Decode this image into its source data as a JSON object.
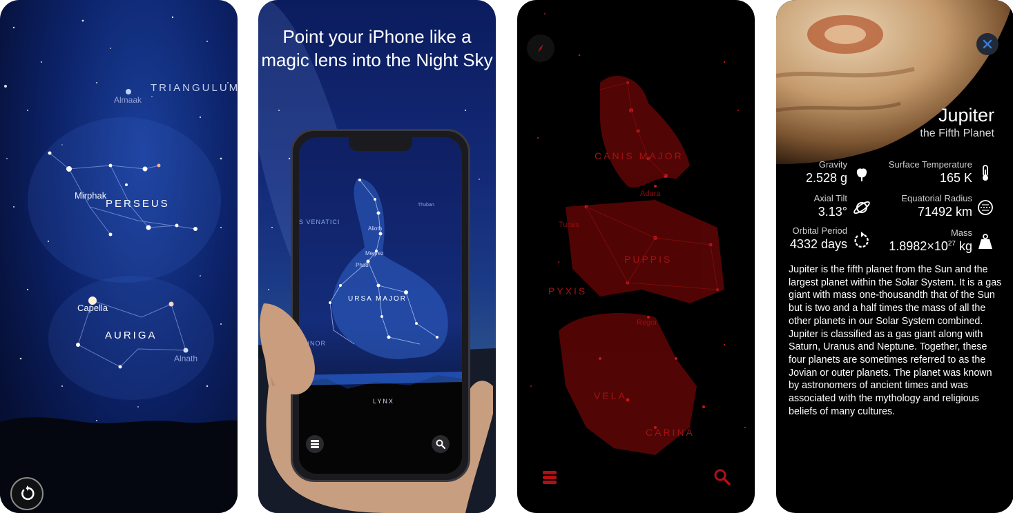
{
  "screen1": {
    "constellations": [
      "TRIANGULUM",
      "PERSEUS",
      "AURIGA"
    ],
    "stars": [
      "Almaak",
      "Mirphak",
      "Capella",
      "Alnath"
    ],
    "reset_icon": "rotate-icon"
  },
  "screen2": {
    "headline": "Point your iPhone like a magic lens into the Night Sky",
    "labels": [
      "S VENATICI",
      "Alioth",
      "Megrez",
      "Phad",
      "URSA MAJOR",
      "MINOR",
      "LYNX",
      "Thuban"
    ],
    "menu_icon": "layers-icon",
    "search_icon": "search-icon"
  },
  "screen3": {
    "constellations": [
      "CANIS MAJOR",
      "PUPPIS",
      "PYXIS",
      "VELA",
      "CARINA"
    ],
    "stars": [
      "Adara",
      "Turais",
      "Regor"
    ],
    "compass_icon": "compass-icon",
    "menu_icon": "layers-icon",
    "search_icon": "search-icon",
    "accent": "#c0141a"
  },
  "screen4": {
    "title": "Jupiter",
    "subtitle": "the Fifth Planet",
    "stats": [
      {
        "label": "Gravity",
        "value": "2.528 g",
        "icon": "apple-icon"
      },
      {
        "label": "Surface Temperature",
        "value": "165 K",
        "icon": "thermometer-icon"
      },
      {
        "label": "Axial Tilt",
        "value": "3.13°",
        "icon": "planet-icon"
      },
      {
        "label": "Equatorial Radius",
        "value": "71492 km",
        "icon": "radius-icon"
      },
      {
        "label": "Orbital Period",
        "value": "4332 days",
        "icon": "orbit-icon"
      },
      {
        "label": "Mass",
        "value_base": "1.8982×10",
        "value_exp": "27",
        "value_unit": " kg",
        "icon": "weight-icon"
      }
    ],
    "description": "Jupiter is the fifth planet from the Sun and the largest planet within the Solar System. It is a gas giant with mass one-thousandth that of the Sun but is two and a half times the mass of all the other planets in our Solar System combined. Jupiter is classified as a gas giant along with Saturn, Uranus and Neptune. Together, these four planets are sometimes referred to as the Jovian or outer planets. The planet was known by astronomers of ancient times and was associated with the mythology and religious beliefs of many cultures.",
    "close_icon": "close-icon",
    "accent": "#3a7bd5"
  }
}
